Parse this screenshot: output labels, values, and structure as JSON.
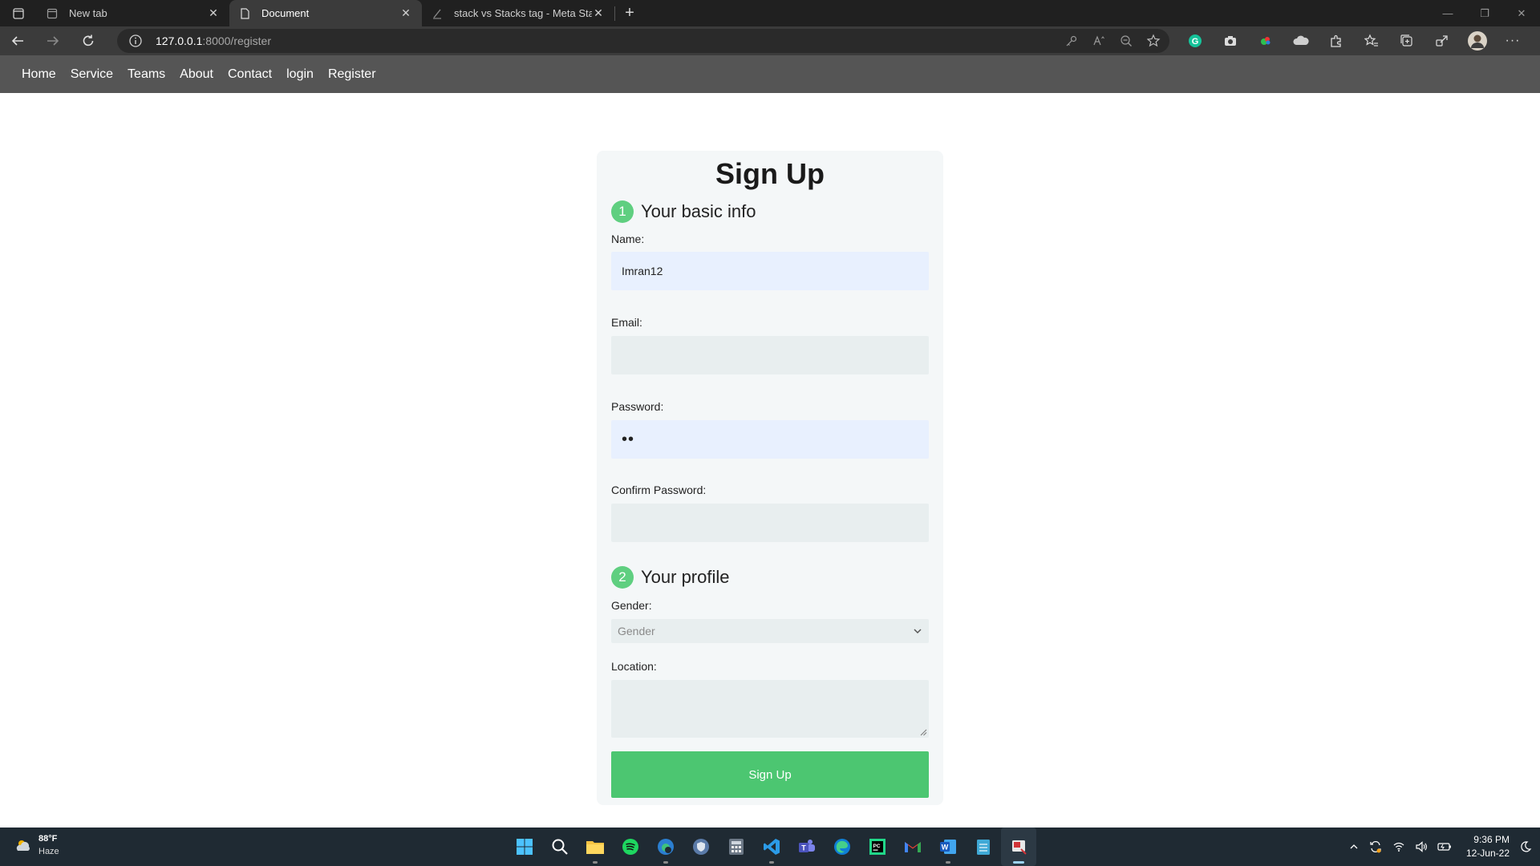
{
  "browser": {
    "tabs": [
      {
        "title": "New tab",
        "icon": "page-icon"
      },
      {
        "title": "Document",
        "icon": "document-icon",
        "active": true
      },
      {
        "title": "stack vs Stacks tag - Meta Stack",
        "icon": "stack-icon"
      }
    ],
    "address": {
      "host": "127.0.0.1",
      "rest": ":8000/register"
    }
  },
  "site_nav": {
    "items": [
      "Home",
      "Service",
      "Teams",
      "About",
      "Contact",
      "login",
      "Register"
    ]
  },
  "form": {
    "title": "Sign Up",
    "section1": {
      "num": "1",
      "title": "Your basic info"
    },
    "name": {
      "label": "Name:",
      "value": "Imran12"
    },
    "email": {
      "label": "Email:",
      "value": ""
    },
    "password": {
      "label": "Password:",
      "value": "••"
    },
    "confirm": {
      "label": "Confirm Password:",
      "value": ""
    },
    "section2": {
      "num": "2",
      "title": "Your profile"
    },
    "gender": {
      "label": "Gender:",
      "selected": "Gender"
    },
    "location": {
      "label": "Location:"
    },
    "submit": "Sign Up",
    "accent": "#4cc671"
  },
  "taskbar": {
    "weather": {
      "temp": "88°F",
      "cond": "Haze"
    },
    "clock": {
      "time": "9:36 PM",
      "date": "12-Jun-22"
    }
  }
}
